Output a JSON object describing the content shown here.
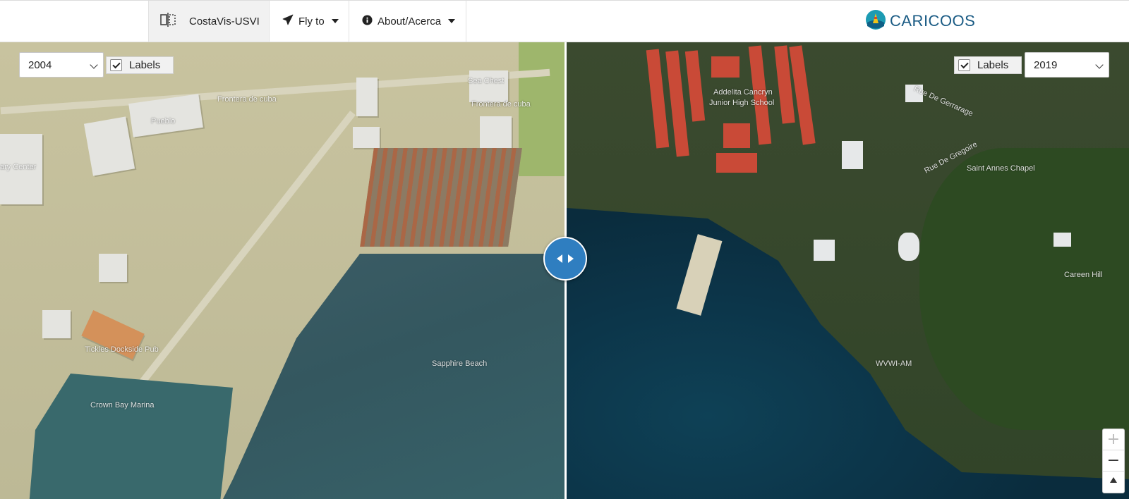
{
  "app": {
    "title": "CostaVis-USVI",
    "brand_icon": "split-view-icon"
  },
  "nav": {
    "fly_to": {
      "label": "Fly to",
      "icon": "paper-plane-icon"
    },
    "about": {
      "label": "About/Acerca",
      "icon": "info-circle-icon"
    }
  },
  "logo": {
    "text": "CARICOOS",
    "icon": "caricoos-buoy-logo"
  },
  "left_panel": {
    "year_select": {
      "value": "2004"
    },
    "labels_toggle": {
      "label": "Labels",
      "checked": true
    },
    "labels": {
      "frontera1": "Frontera de cuba",
      "sea_chest": "Sea Chest",
      "frontera2": "Frontera de cuba",
      "pueblo": "Pueblo",
      "center": "ary Center",
      "pub": "Tickles Dockside Pub",
      "marina": "Crown Bay Marina",
      "beach": "Sapphire Beach"
    }
  },
  "right_panel": {
    "year_select": {
      "value": "2019"
    },
    "labels_toggle": {
      "label": "Labels",
      "checked": true
    },
    "labels": {
      "school_line1": "Addelita Cancryn",
      "school_line2": "Junior High School",
      "rue1": "Rue De Gerrarage",
      "rue2": "Rue De Gregoire",
      "chapel": "Saint Annes Chapel",
      "hill": "Careen Hill",
      "radio": "WVWI-AM"
    }
  },
  "split_handle": {
    "icon": "left-right-arrows-icon"
  },
  "zoom": {
    "in": "+",
    "out": "−",
    "compass_icon": "compass-north-icon"
  },
  "colors": {
    "accent": "#2f7ec0",
    "brand": "#1a5b84"
  }
}
